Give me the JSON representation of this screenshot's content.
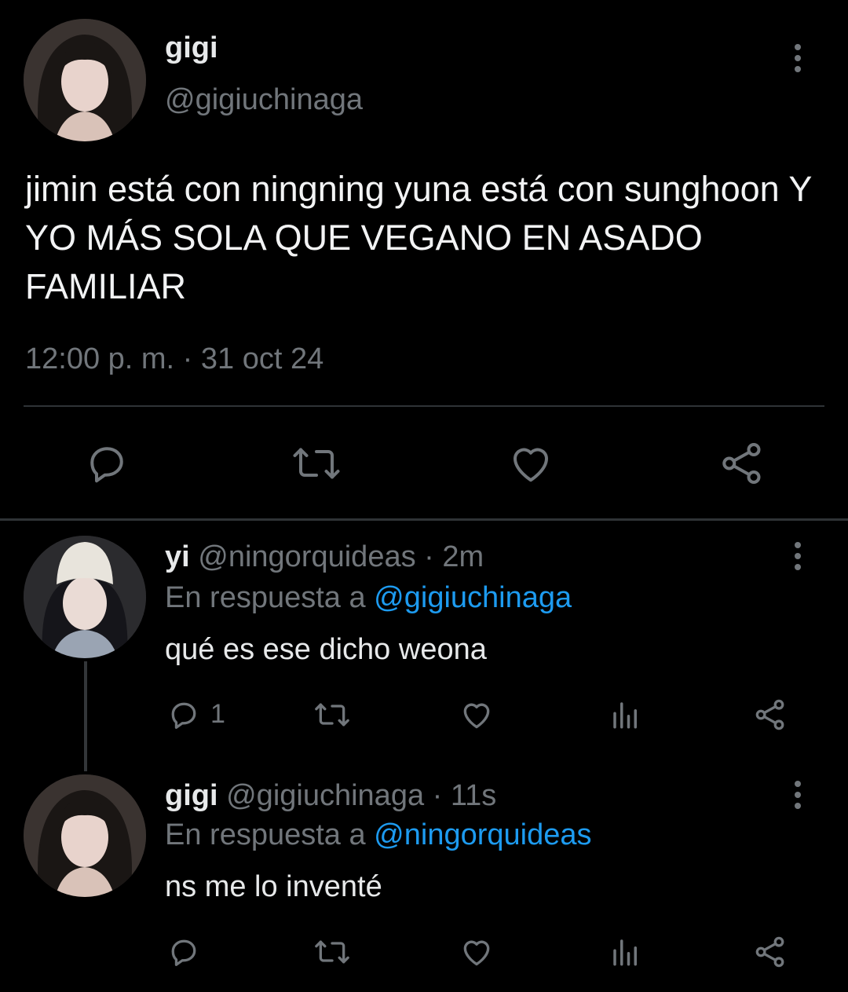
{
  "main_tweet": {
    "name": "gigi",
    "handle": "@gigiuchinaga",
    "text": "jimin está con ningning yuna está con sunghoon Y YO MÁS SOLA QUE VEGANO EN ASADO FAMILIAR",
    "timestamp": "12:00 p. m. · 31 oct 24"
  },
  "replies": [
    {
      "name": "yi",
      "handle_time": "@ningorquideas · 2m",
      "reply_prefix": "En respuesta a",
      "reply_to": "@gigiuchinaga",
      "text": "qué es ese dicho weona",
      "reply_count": "1"
    },
    {
      "name": "gigi",
      "handle_time": "@gigiuchinaga · 11s",
      "reply_prefix": "En respuesta a",
      "reply_to": "@ningorquideas",
      "text": "ns me lo inventé",
      "reply_count": ""
    }
  ],
  "icons": {
    "reply": "reply-icon",
    "retweet": "retweet-icon",
    "like": "like-icon",
    "views": "views-icon",
    "share": "share-icon",
    "more": "more-icon"
  },
  "colors": {
    "background": "#000000",
    "text": "#e7e9ea",
    "secondary": "#71767b",
    "link": "#1d9bf0"
  }
}
